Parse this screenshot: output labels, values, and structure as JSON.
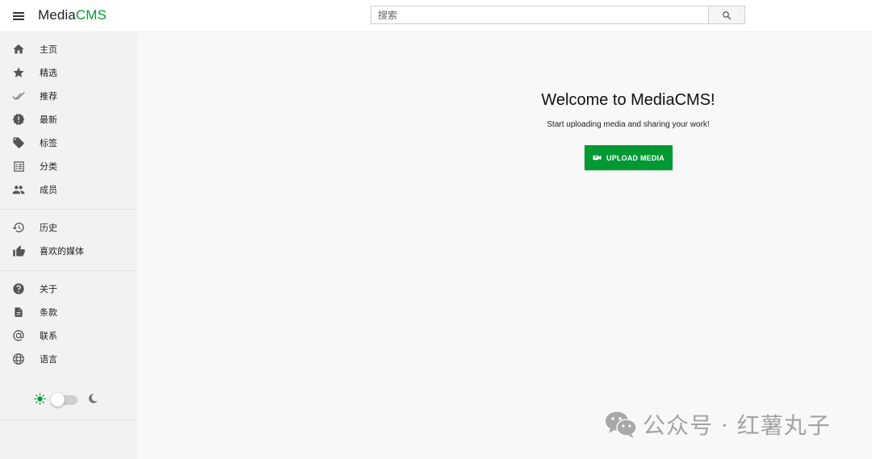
{
  "header": {
    "logo_part1": "Media",
    "logo_part2": "CMS",
    "search_placeholder": "搜索"
  },
  "sidebar": {
    "items": [
      {
        "label": "主页",
        "icon": "home-icon"
      },
      {
        "label": "精选",
        "icon": "star-icon"
      },
      {
        "label": "推荐",
        "icon": "double-check-icon"
      },
      {
        "label": "最新",
        "icon": "new-badge-icon"
      },
      {
        "label": "标签",
        "icon": "tag-icon"
      },
      {
        "label": "分类",
        "icon": "list-alt-icon"
      },
      {
        "label": "成员",
        "icon": "people-icon"
      }
    ],
    "user_items": [
      {
        "label": "历史",
        "icon": "history-icon"
      },
      {
        "label": "喜欢的媒体",
        "icon": "thumb-up-icon"
      }
    ],
    "info_items": [
      {
        "label": "关于",
        "icon": "help-icon"
      },
      {
        "label": "条款",
        "icon": "document-icon"
      },
      {
        "label": "联系",
        "icon": "at-icon"
      },
      {
        "label": "语言",
        "icon": "globe-icon"
      }
    ],
    "theme": {
      "light_icon": "sun-icon",
      "dark_icon": "moon-icon",
      "dark_mode": false
    }
  },
  "main": {
    "title": "Welcome to MediaCMS!",
    "subtitle": "Start uploading media and sharing your work!",
    "upload_label": "UPLOAD MEDIA"
  },
  "watermark": {
    "text": "公众号 · 红薯丸子",
    "icon": "wechat-icon"
  },
  "colors": {
    "accent": "#009933",
    "sidebar_bg": "#f2f2f2",
    "main_bg": "#f8f8f8"
  }
}
